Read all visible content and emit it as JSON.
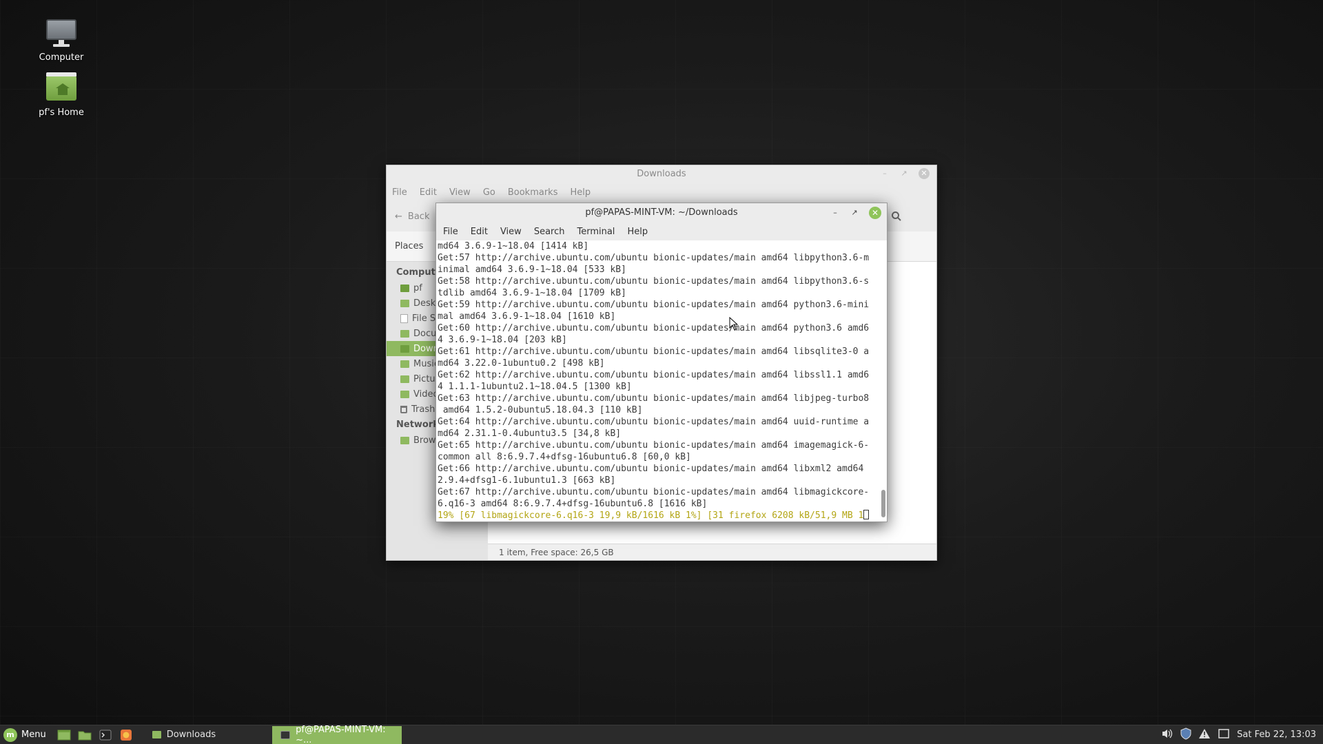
{
  "desktop": {
    "icons": [
      {
        "label": "Computer"
      },
      {
        "label": "pf's Home"
      }
    ]
  },
  "file_manager": {
    "title": "Downloads",
    "menu": [
      "File",
      "Edit",
      "View",
      "Go",
      "Bookmarks",
      "Help"
    ],
    "back_label": "Back",
    "places_label": "Places",
    "sidebar": {
      "computer_header": "Computer",
      "items": [
        "pf",
        "Desktop",
        "File System",
        "Documents",
        "Downloads",
        "Music",
        "Pictures",
        "Videos",
        "Trash"
      ],
      "network_header": "Network",
      "network_items": [
        "Browse Network"
      ]
    },
    "status": "1 item, Free space: 26,5 GB"
  },
  "terminal": {
    "title": "pf@PAPAS-MINT-VM: ~/Downloads",
    "menu": [
      "File",
      "Edit",
      "View",
      "Search",
      "Terminal",
      "Help"
    ],
    "lines": [
      "md64 3.6.9-1~18.04 [1414 kB]",
      "Get:57 http://archive.ubuntu.com/ubuntu bionic-updates/main amd64 libpython3.6-m",
      "inimal amd64 3.6.9-1~18.04 [533 kB]",
      "Get:58 http://archive.ubuntu.com/ubuntu bionic-updates/main amd64 libpython3.6-s",
      "tdlib amd64 3.6.9-1~18.04 [1709 kB]",
      "Get:59 http://archive.ubuntu.com/ubuntu bionic-updates/main amd64 python3.6-mini",
      "mal amd64 3.6.9-1~18.04 [1610 kB]",
      "Get:60 http://archive.ubuntu.com/ubuntu bionic-updates/main amd64 python3.6 amd6",
      "4 3.6.9-1~18.04 [203 kB]",
      "Get:61 http://archive.ubuntu.com/ubuntu bionic-updates/main amd64 libsqlite3-0 a",
      "md64 3.22.0-1ubuntu0.2 [498 kB]",
      "Get:62 http://archive.ubuntu.com/ubuntu bionic-updates/main amd64 libssl1.1 amd6",
      "4 1.1.1-1ubuntu2.1~18.04.5 [1300 kB]",
      "Get:63 http://archive.ubuntu.com/ubuntu bionic-updates/main amd64 libjpeg-turbo8",
      " amd64 1.5.2-0ubuntu5.18.04.3 [110 kB]",
      "Get:64 http://archive.ubuntu.com/ubuntu bionic-updates/main amd64 uuid-runtime a",
      "md64 2.31.1-0.4ubuntu3.5 [34,8 kB]",
      "Get:65 http://archive.ubuntu.com/ubuntu bionic-updates/main amd64 imagemagick-6-",
      "common all 8:6.9.7.4+dfsg-16ubuntu6.8 [60,0 kB]",
      "Get:66 http://archive.ubuntu.com/ubuntu bionic-updates/main amd64 libxml2 amd64",
      "2.9.4+dfsg1-6.1ubuntu1.3 [663 kB]",
      "Get:67 http://archive.ubuntu.com/ubuntu bionic-updates/main amd64 libmagickcore-",
      "6.q16-3 amd64 8:6.9.7.4+dfsg-16ubuntu6.8 [1616 kB]"
    ],
    "progress_line": "19% [67 libmagickcore-6.q16-3 19,9 kB/1616 kB 1%] [31 firefox 6208 kB/51,9 MB 1"
  },
  "taskbar": {
    "menu_label": "Menu",
    "tasks": [
      {
        "label": "Downloads"
      },
      {
        "label": "pf@PAPAS-MINT-VM: ~..."
      }
    ],
    "clock": "Sat Feb 22, 13:03"
  },
  "colors": {
    "accent": "#8fb960",
    "progress_text": "#b3a514"
  }
}
